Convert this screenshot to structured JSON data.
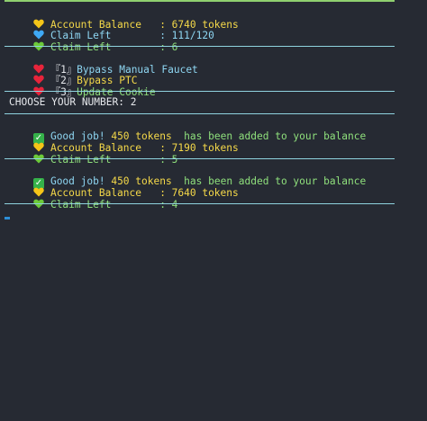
{
  "status_1": {
    "balance_label": "Account Balance   : 6740 tokens",
    "claim_left_label": "Claim Left        : 111/120",
    "claim_left_2_label": "Claim Left        : 6"
  },
  "menu": {
    "items": [
      {
        "key": "『1』",
        "label": "Bypass Manual Faucet"
      },
      {
        "key": "『2』",
        "label": "Bypass PTC"
      },
      {
        "key": "『3』",
        "label": "Update Cookie"
      }
    ]
  },
  "prompt": {
    "text": "CHOOSE YOUR NUMBER: 2"
  },
  "result_1": {
    "good_job": "Good job!",
    "amount": "450 tokens",
    "message": " has been added to your balance",
    "balance_label": "Account Balance   : 7190 tokens",
    "claim_left_label": "Claim Left        : 5"
  },
  "result_2": {
    "good_job": "Good job!",
    "amount": "450 tokens",
    "message": " has been added to your balance",
    "balance_label": "Account Balance   : 7640 tokens",
    "claim_left_label": "Claim Left        : 4"
  },
  "colors": {
    "background": "#262a33",
    "yellow": "#f5d949",
    "blue": "#8ed6f2",
    "green": "#8fe07c",
    "rule": "#8fd3df",
    "red": "#ff4f57"
  }
}
